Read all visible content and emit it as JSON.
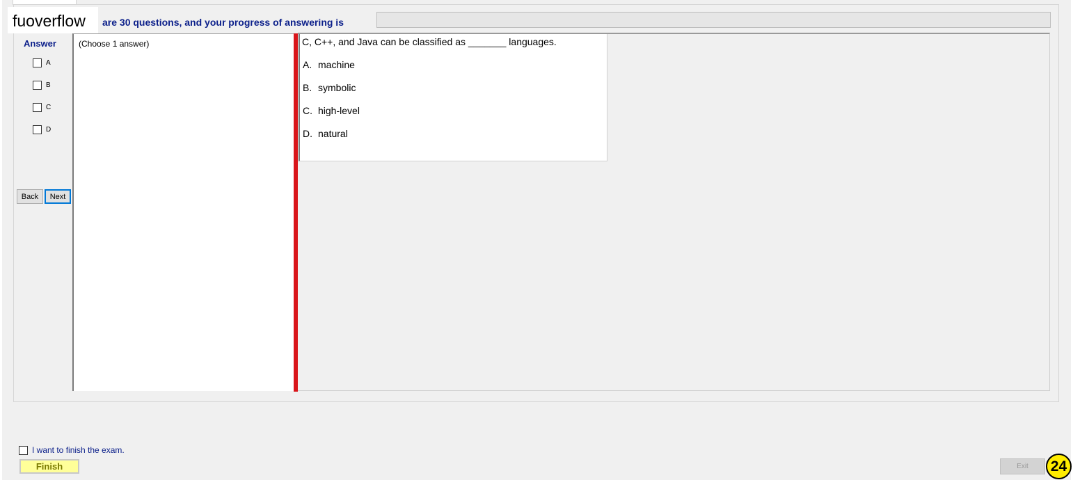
{
  "watermark": "fuoverflow",
  "header": {
    "text": "are 30 questions, and your progress of answering is",
    "progress": 0
  },
  "answer_panel": {
    "title": "Answer",
    "options": [
      "A",
      "B",
      "C",
      "D"
    ]
  },
  "nav": {
    "back_label": "Back",
    "next_label": "Next"
  },
  "instructions": "(Choose 1 answer)",
  "question": {
    "stem": "C, C++, and Java can be classified as _______ languages.",
    "options": [
      {
        "letter": "A.",
        "text": "machine"
      },
      {
        "letter": "B.",
        "text": "symbolic"
      },
      {
        "letter": "C.",
        "text": "high-level"
      },
      {
        "letter": "D.",
        "text": "natural"
      }
    ]
  },
  "footer": {
    "finish_checkbox_label": "I want to finish the exam.",
    "finish_label": "Finish",
    "exit_label": "Exit",
    "question_number": "24"
  },
  "colors": {
    "accent_text": "#0b1f8a",
    "divider": "#d9161b",
    "badge": "#ffec00",
    "finish_button": "#ffff99"
  }
}
